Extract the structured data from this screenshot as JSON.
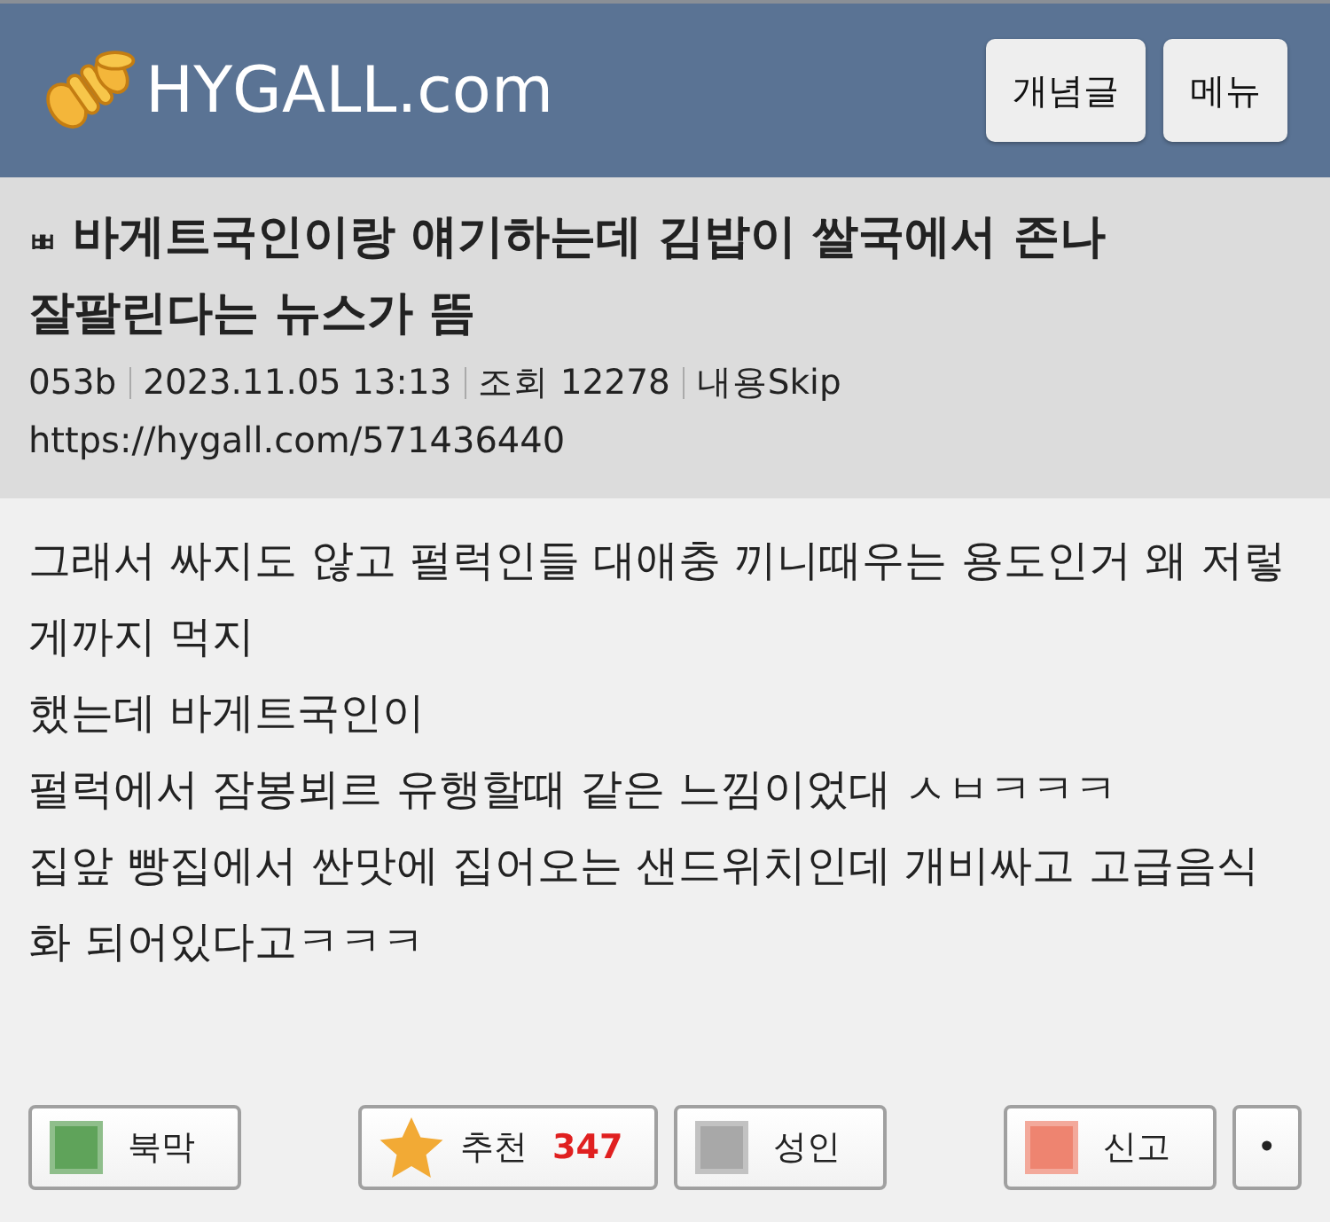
{
  "header": {
    "logo": "HYGALL.com",
    "buttons": [
      {
        "label": "개념글"
      },
      {
        "label": "메뉴"
      }
    ]
  },
  "post": {
    "prefix": "ㅃ",
    "title": "바게트국인이랑 얘기하는데 김밥이 쌀국에서 존나 잘팔린다는 뉴스가 뜸",
    "meta": [
      "053b",
      "2023.11.05 13:13",
      "조회 12278",
      "내용Skip"
    ],
    "url": "https://hygall.com/571436440"
  },
  "body": {
    "lines": [
      "그래서 싸지도 않고 펄럭인들 대애충 끼니때우는 용도인거 왜 저렇게까지 먹지",
      "했는데 바게트국인이",
      "펄럭에서 잠봉뵈르 유행할때 같은 느낌이었대 ㅅㅂㅋㅋㅋ",
      "집앞 빵집에서 싼맛에 집어오는 샌드위치인데 개비싸고 고급음식화 되어있다고ㅋㅋㅋ"
    ]
  },
  "actions": {
    "left": [
      {
        "kind": "swatch",
        "label": "북막",
        "color": "#5fa35a"
      }
    ],
    "center": [
      {
        "kind": "star",
        "label": "추천",
        "count": "347"
      },
      {
        "kind": "swatch",
        "label": "성인",
        "color": "#a8a8a8"
      }
    ],
    "right": [
      {
        "kind": "swatch",
        "label": "신고",
        "color": "#ee8470"
      },
      {
        "kind": "plain",
        "label": "•"
      }
    ]
  }
}
